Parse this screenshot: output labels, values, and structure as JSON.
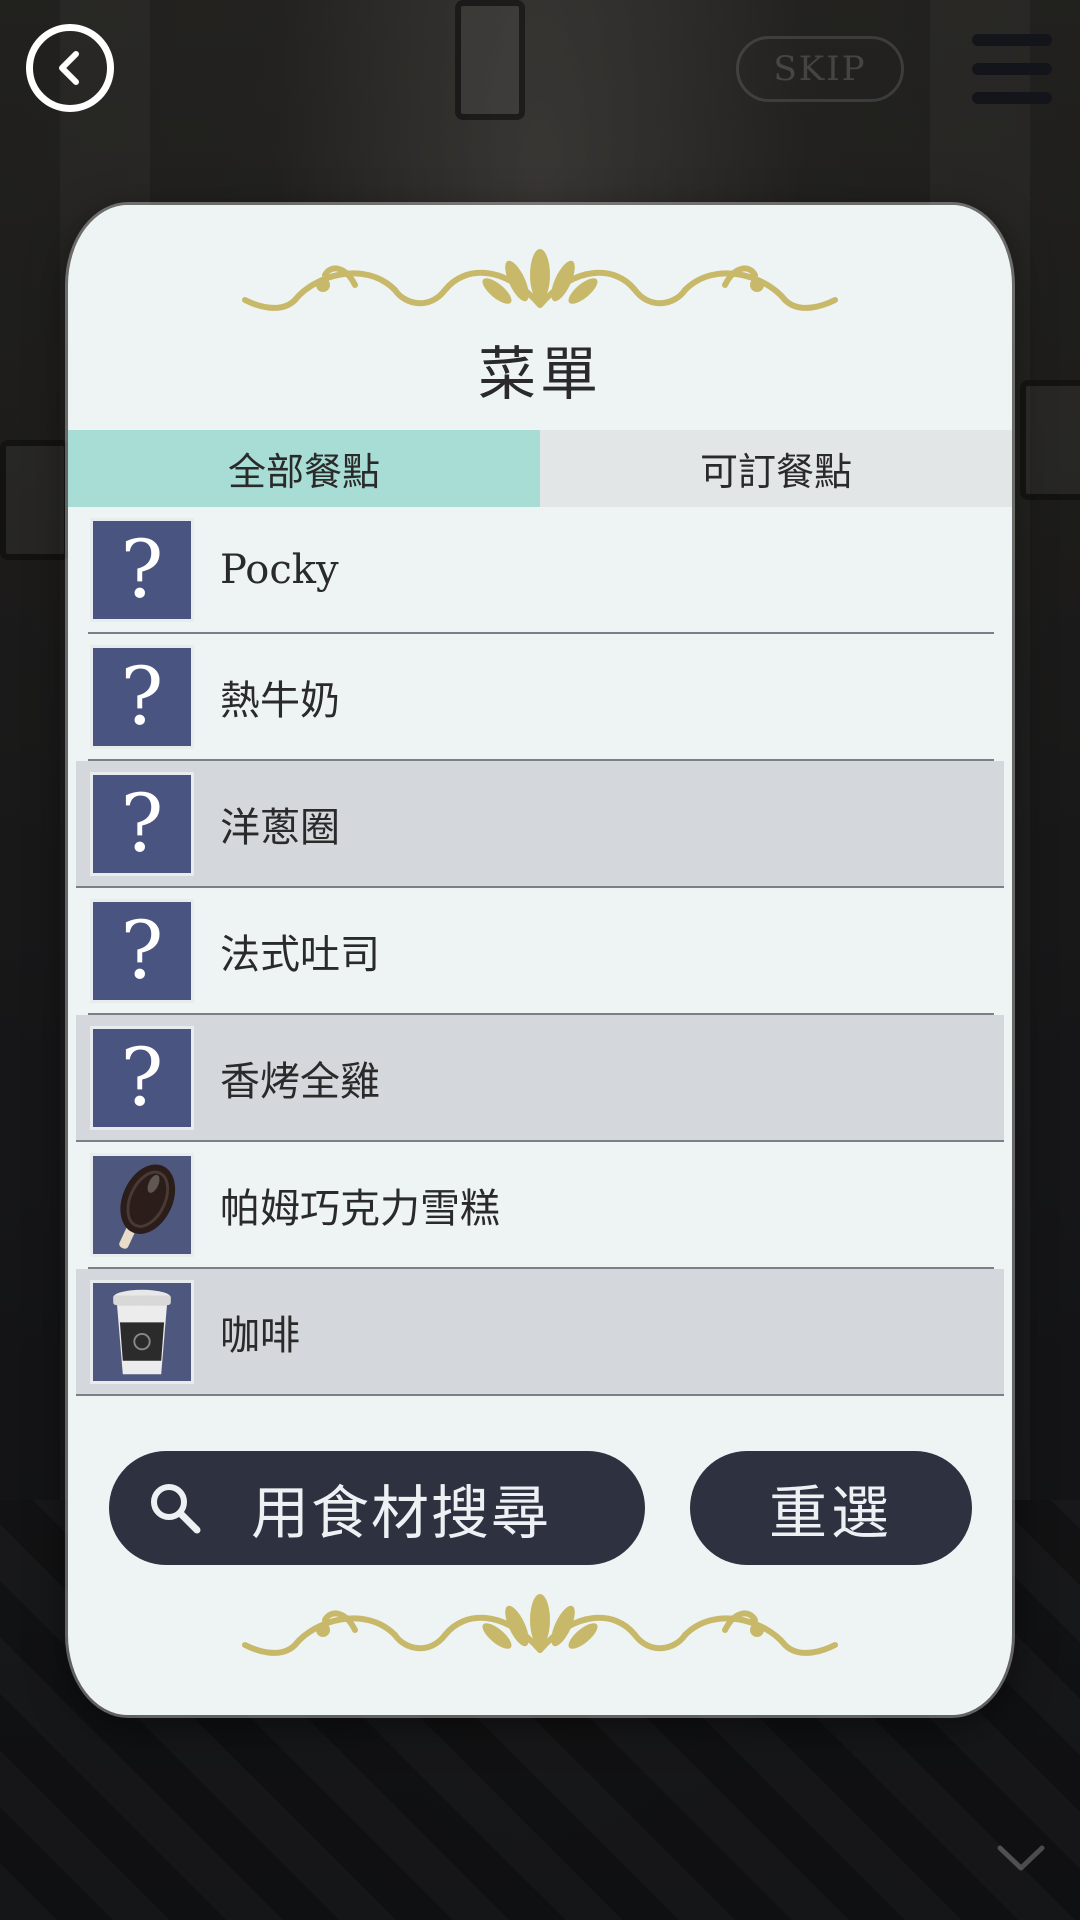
{
  "header": {
    "skip_label": "SKIP"
  },
  "menu_card": {
    "title": "菜單",
    "tabs": [
      {
        "label": "全部餐點",
        "active": true
      },
      {
        "label": "可訂餐點",
        "active": false
      }
    ],
    "items": [
      {
        "name": "Pocky",
        "icon": "question-mark",
        "shaded": false
      },
      {
        "name": "熱牛奶",
        "icon": "question-mark",
        "shaded": false
      },
      {
        "name": "洋蔥圈",
        "icon": "question-mark",
        "shaded": true
      },
      {
        "name": "法式吐司",
        "icon": "question-mark",
        "shaded": false
      },
      {
        "name": "香烤全雞",
        "icon": "question-mark",
        "shaded": true
      },
      {
        "name": "帕姆巧克力雪糕",
        "icon": "chocolate-ice-cream-bar",
        "shaded": false
      },
      {
        "name": "咖啡",
        "icon": "coffee-cup",
        "shaded": true
      }
    ],
    "unknown_glyph": "?",
    "search_label": "用食材搜尋",
    "reset_label": "重選"
  },
  "colors": {
    "card_bg": "#eef4f4",
    "active_tab": "#a8ddd6",
    "inactive_tab": "#e3e6e7",
    "button_dark": "#2d3140",
    "thumb_bg": "#4a5480",
    "ornament_gold": "#c8b96a"
  }
}
